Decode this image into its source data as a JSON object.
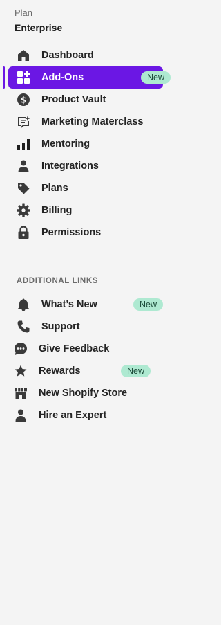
{
  "plan": {
    "label": "Plan",
    "value": "Enterprise"
  },
  "nav": {
    "items": [
      {
        "label": "Dashboard",
        "icon": "home-icon"
      },
      {
        "label": "Add-Ons",
        "icon": "add-ons-icon",
        "badge": "New",
        "active": true
      },
      {
        "label": "Product Vault",
        "icon": "dollar-icon"
      },
      {
        "label": "Marketing Materclass",
        "icon": "speech-bubble-icon"
      },
      {
        "label": "Mentoring",
        "icon": "signal-bars-icon"
      },
      {
        "label": "Integrations",
        "icon": "person-icon"
      },
      {
        "label": "Plans",
        "icon": "tag-icon"
      },
      {
        "label": "Billing",
        "icon": "gear-icon"
      },
      {
        "label": "Permissions",
        "icon": "lock-icon"
      }
    ]
  },
  "additional": {
    "title": "ADDITIONAL LINKS",
    "items": [
      {
        "label": "What’s New",
        "icon": "bell-icon",
        "badge": "New"
      },
      {
        "label": "Support",
        "icon": "phone-icon"
      },
      {
        "label": "Give Feedback",
        "icon": "chat-icon"
      },
      {
        "label": "Rewards",
        "icon": "star-icon",
        "badge": "New"
      },
      {
        "label": "New Shopify Store",
        "icon": "store-icon"
      },
      {
        "label": "Hire an Expert",
        "icon": "person-icon"
      }
    ]
  },
  "colors": {
    "accent": "#6b17e4",
    "badge_bg": "#aee9d1",
    "icon": "#3a3a3a"
  }
}
